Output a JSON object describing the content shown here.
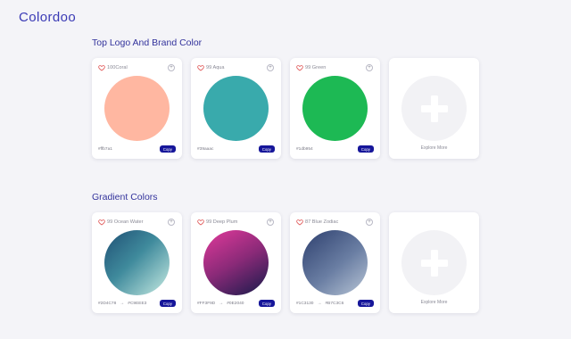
{
  "brand": "Colordoo",
  "sections": [
    {
      "title": "Top Logo And Brand Color",
      "cards": [
        {
          "label": "100Coral",
          "hex": "#ffb7a1",
          "color": "#ffb7a1",
          "copy": "Copy"
        },
        {
          "label": "99 Aqua",
          "hex": "#39aaac",
          "color": "#39aaac",
          "copy": "Copy"
        },
        {
          "label": "99 Green",
          "hex": "#1db954",
          "color": "#1db954",
          "copy": "Copy"
        }
      ],
      "explore": "Explore More"
    },
    {
      "title": "Gradient Colors",
      "cards": [
        {
          "label": "99 Ocean Water",
          "from": "#2D4C78",
          "to": "#C9EEE3",
          "arrow": "→",
          "copy": "Copy"
        },
        {
          "label": "99 Deep Plum",
          "from": "#FF3F9D",
          "to": "#0E2040",
          "arrow": "→",
          "copy": "Copy"
        },
        {
          "label": "87 Blue Zodiac",
          "from": "#1C3130",
          "to": "#B7C3C6",
          "arrow": "→",
          "copy": "Copy"
        }
      ],
      "explore": "Explore More"
    }
  ],
  "colors": {
    "accent": "#16169a",
    "heart": "#e05a5a",
    "gradients": [
      [
        "#1f4f74",
        "#c8ece3"
      ],
      [
        "#e23a9b",
        "#161a4a"
      ],
      [
        "#2d3f6e",
        "#b9c6d6"
      ]
    ]
  }
}
